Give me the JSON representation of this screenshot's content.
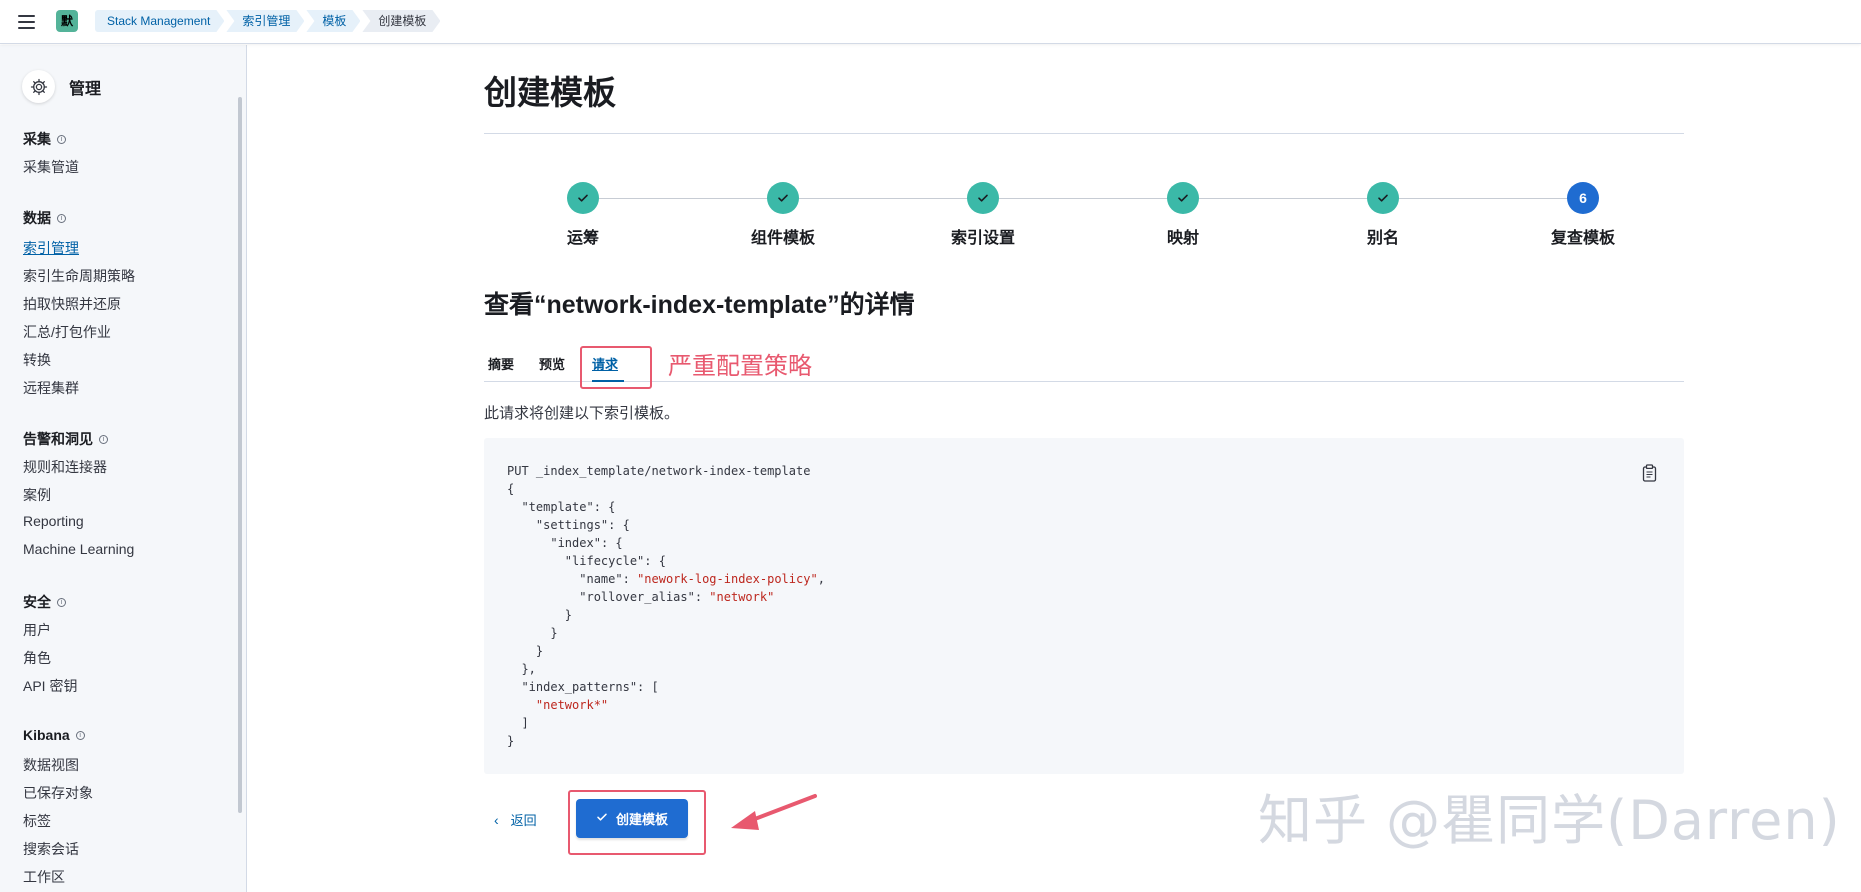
{
  "header": {
    "space_initial": "默",
    "breadcrumbs": [
      "Stack Management",
      "索引管理",
      "模板",
      "创建模板"
    ]
  },
  "sidebar": {
    "title": "管理",
    "groups": [
      {
        "title": "采集",
        "items": [
          "采集管道"
        ]
      },
      {
        "title": "数据",
        "items": [
          "索引管理",
          "索引生命周期策略",
          "拍取快照并还原",
          "汇总/打包作业",
          "转换",
          "远程集群"
        ]
      },
      {
        "title": "告警和洞见",
        "items": [
          "规则和连接器",
          "案例",
          "Reporting",
          "Machine Learning"
        ]
      },
      {
        "title": "安全",
        "items": [
          "用户",
          "角色",
          "API 密钥"
        ]
      },
      {
        "title": "Kibana",
        "items": [
          "数据视图",
          "已保存对象",
          "标签",
          "搜索会话",
          "工作区"
        ]
      }
    ],
    "active_item": "索引管理"
  },
  "main": {
    "page_title": "创建模板",
    "steps": [
      {
        "label": "运筹",
        "status": "complete"
      },
      {
        "label": "组件模板",
        "status": "complete"
      },
      {
        "label": "索引设置",
        "status": "complete"
      },
      {
        "label": "映射",
        "status": "complete"
      },
      {
        "label": "别名",
        "status": "complete"
      },
      {
        "label": "复查模板",
        "status": "current",
        "number": "6"
      }
    ],
    "details_title": "查看“network-index-template”的详情",
    "tabs": [
      {
        "label": "摘要",
        "active": false
      },
      {
        "label": "预览",
        "active": false
      },
      {
        "label": "请求",
        "active": true
      }
    ],
    "annotation": "严重配置策略",
    "request_description": "此请求将创建以下索引模板。",
    "code_request_line": "PUT _index_template/network-index-template",
    "code": {
      "open_brace": "{",
      "template_key": "\"template\"",
      "settings_key": "\"settings\"",
      "index_key": "\"index\"",
      "lifecycle_key": "\"lifecycle\"",
      "name_key": "\"name\"",
      "name_value": "\"nework-log-index-policy\"",
      "rollover_key": "\"rollover_alias\"",
      "rollover_value": "\"network\"",
      "index_patterns_key": "\"index_patterns\"",
      "pattern_value": "\"network*\""
    },
    "back_label": "返回",
    "create_label": "创建模板"
  },
  "watermark": "知乎 @瞿同学(Darren)",
  "colors": {
    "primary": "#1f6cd1",
    "step_complete": "#3bb9a8",
    "annotation_red": "#e8596f",
    "link": "#0061a6"
  }
}
